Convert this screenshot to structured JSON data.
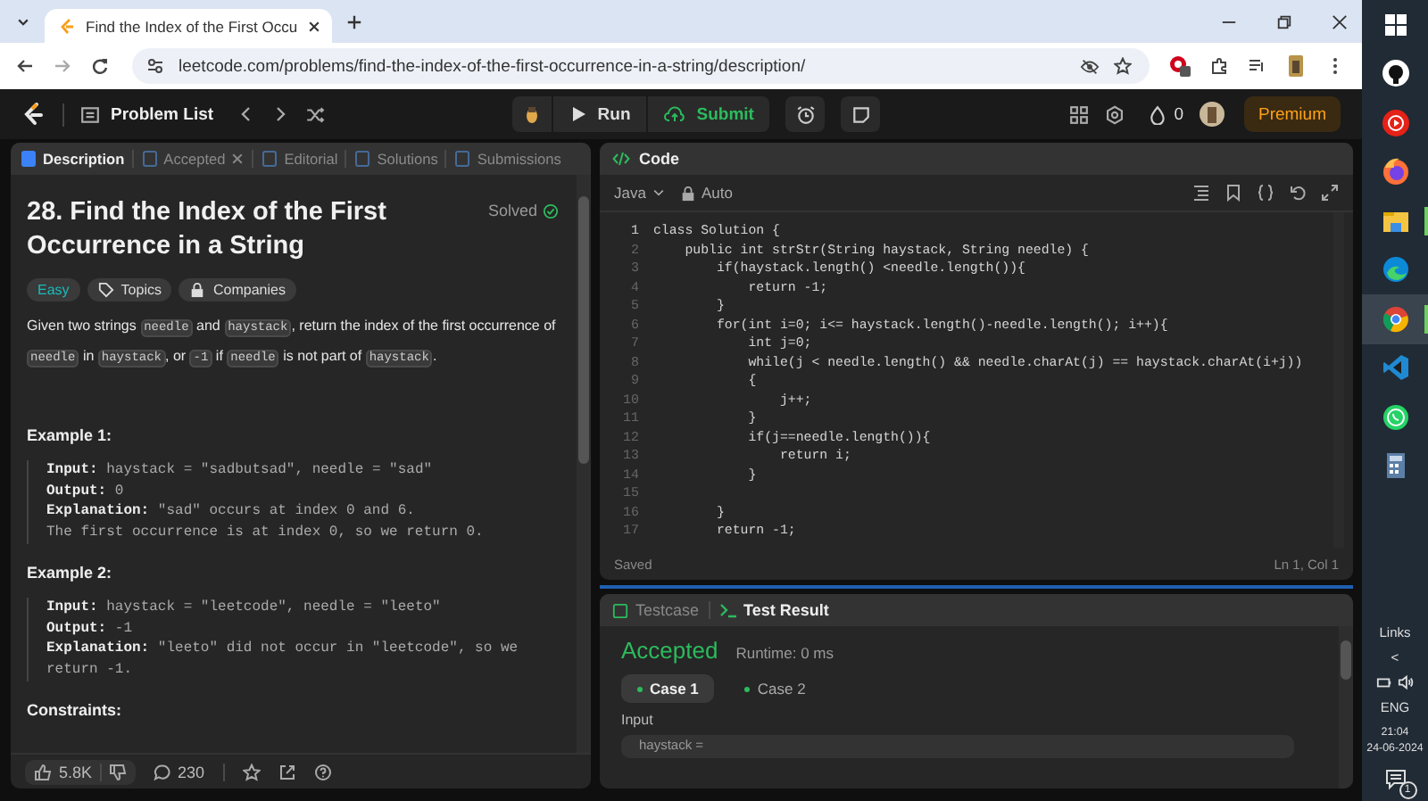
{
  "browser": {
    "tab_title": "Find the Index of the First Occu",
    "url": "leetcode.com/problems/find-the-index-of-the-first-occurrence-in-a-string/description/"
  },
  "header": {
    "problem_list": "Problem List",
    "run": "Run",
    "submit": "Submit",
    "streak": "0",
    "premium": "Premium"
  },
  "left_tabs": [
    {
      "label": "Description",
      "selected": true,
      "closable": false
    },
    {
      "label": "Accepted",
      "selected": false,
      "closable": true
    },
    {
      "label": "Editorial",
      "selected": false,
      "closable": false
    },
    {
      "label": "Solutions",
      "selected": false,
      "closable": false
    },
    {
      "label": "Submissions",
      "selected": false,
      "closable": false
    }
  ],
  "problem": {
    "title": "28. Find the Index of the First Occurrence in a String",
    "status": "Solved",
    "difficulty": "Easy",
    "tags": [
      "Topics",
      "Companies"
    ],
    "description": [
      {
        "text": "Given two strings ",
        "code": false
      },
      {
        "text": "needle",
        "code": true
      },
      {
        "text": " and ",
        "code": false
      },
      {
        "text": "haystack",
        "code": true
      },
      {
        "text": ", return the index of the first occurrence of ",
        "code": false
      },
      {
        "text": "needle",
        "code": true
      },
      {
        "text": " in ",
        "code": false
      },
      {
        "text": "haystack",
        "code": true
      },
      {
        "text": ", or ",
        "code": false
      },
      {
        "text": "-1",
        "code": true
      },
      {
        "text": " if ",
        "code": false
      },
      {
        "text": "needle",
        "code": true
      },
      {
        "text": " is not part of ",
        "code": false
      },
      {
        "text": "haystack",
        "code": true
      },
      {
        "text": ".",
        "code": false
      }
    ],
    "examples": [
      {
        "heading": "Example 1:",
        "lines": [
          "**Input:** haystack = \"sadbutsad\", needle = \"sad\"",
          "**Output:** 0",
          "**Explanation:** \"sad\" occurs at index 0 and 6.",
          "The first occurrence is at index 0, so we return 0."
        ]
      },
      {
        "heading": "Example 2:",
        "lines": [
          "**Input:** haystack = \"leetcode\", needle = \"leeto\"",
          "**Output:** -1",
          "**Explanation:** \"leeto\" did not occur in \"leetcode\", so we return -1."
        ]
      }
    ],
    "next_heading": "Constraints:"
  },
  "stats": {
    "likes": "5.8K",
    "comments": "230"
  },
  "code_panel": {
    "title": "Code",
    "language": "Java",
    "mode": "Auto",
    "status": "Saved",
    "cursor": "Ln 1, Col 1",
    "lines": [
      {
        "n": "1",
        "code": "class Solution {"
      },
      {
        "n": "2",
        "code": "    public int strStr(String haystack, String needle) {"
      },
      {
        "n": "3",
        "code": "        if(haystack.length() <needle.length()){"
      },
      {
        "n": "4",
        "code": "            return -1;"
      },
      {
        "n": "5",
        "code": "        }"
      },
      {
        "n": "6",
        "code": "        for(int i=0; i<= haystack.length()-needle.length(); i++){"
      },
      {
        "n": "7",
        "code": "            int j=0;"
      },
      {
        "n": "8",
        "code": "            while(j < needle.length() && needle.charAt(j) == haystack.charAt(i+j))"
      },
      {
        "n": "9",
        "code": "            {"
      },
      {
        "n": "10",
        "code": "                j++;"
      },
      {
        "n": "11",
        "code": "            }"
      },
      {
        "n": "12",
        "code": "            if(j==needle.length()){"
      },
      {
        "n": "13",
        "code": "                return i;"
      },
      {
        "n": "14",
        "code": "            }"
      },
      {
        "n": "15"
      },
      {
        "n": "16",
        "code": "        }"
      },
      {
        "n": "17",
        "code": "        return -1;"
      }
    ]
  },
  "result_panel": {
    "tabs": [
      {
        "label": "Testcase",
        "selected": false
      },
      {
        "label": "Test Result",
        "selected": true
      }
    ],
    "verdict": "Accepted",
    "runtime": "Runtime: 0 ms",
    "cases": [
      {
        "label": "Case 1",
        "selected": true
      },
      {
        "label": "Case 2",
        "selected": false
      }
    ],
    "input_label": "Input",
    "input_value": "haystack ="
  },
  "taskbar": {
    "apps": [
      {
        "kind": "windows",
        "running": false,
        "selected": false
      },
      {
        "kind": "github",
        "running": false,
        "selected": false
      },
      {
        "kind": "music",
        "running": false,
        "selected": false
      },
      {
        "kind": "firefox",
        "running": false,
        "selected": false
      },
      {
        "kind": "files",
        "running": true,
        "selected": false
      },
      {
        "kind": "edge",
        "running": false,
        "selected": false
      },
      {
        "kind": "chrome",
        "running": true,
        "selected": true
      },
      {
        "kind": "vscode",
        "running": false,
        "selected": false
      },
      {
        "kind": "whatsapp",
        "running": false,
        "selected": false
      },
      {
        "kind": "calculator",
        "running": false,
        "selected": false
      }
    ],
    "links": "Links",
    "chevron": "<",
    "language": "ENG",
    "time": "21:04",
    "date": "24-06-2024",
    "notifications": "1"
  }
}
